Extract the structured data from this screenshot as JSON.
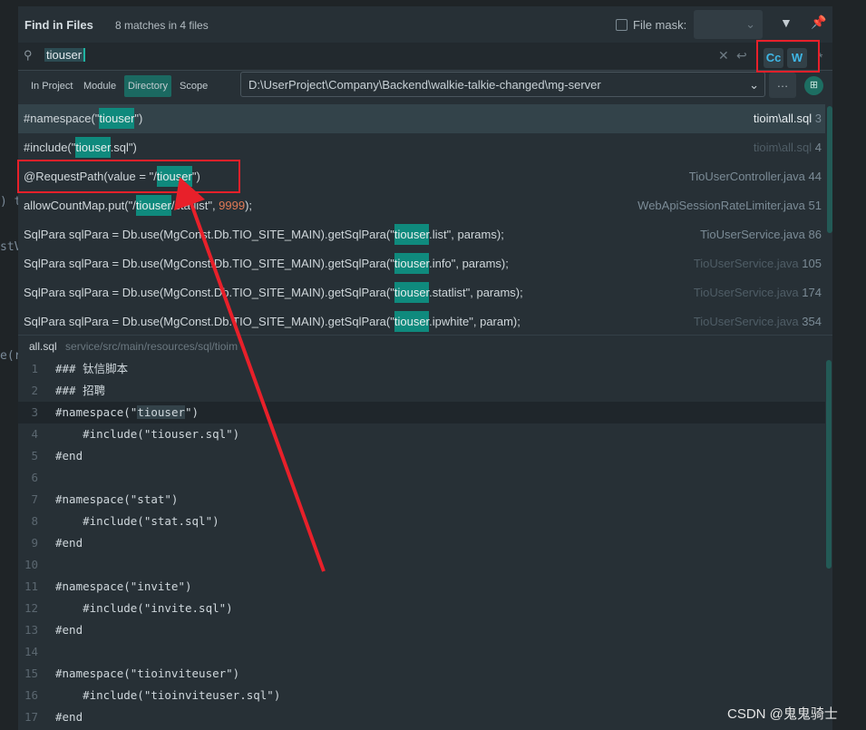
{
  "dialog": {
    "title": "Find in Files",
    "match_count": "8 matches in 4 files",
    "file_mask_label": "File mask:",
    "file_mask_checked": false
  },
  "search": {
    "query": "tiouser",
    "match_case": "Cc",
    "words": "W",
    "regex": "*"
  },
  "scopes": [
    {
      "label": "In Project",
      "selected": false
    },
    {
      "label": "Module",
      "selected": false
    },
    {
      "label": "Directory",
      "selected": true
    },
    {
      "label": "Scope",
      "selected": false
    }
  ],
  "directory": "D:\\UserProject\\Company\\Backend\\walkie-talkie-changed\\mg-server",
  "results": [
    {
      "pre": "#namespace(\"",
      "match": "tiouser",
      "post": "\")",
      "file": "tioim\\all.sql",
      "line": "3",
      "selected": true
    },
    {
      "pre": "#include(\"",
      "match": "tiouser",
      "post": ".sql\")",
      "file": "tioim\\all.sql",
      "line": "4"
    },
    {
      "pre": "@RequestPath(value = \"/",
      "match": "tiouser",
      "post": "\")",
      "file": "TioUserController.java",
      "line": "44"
    },
    {
      "pre": "allowCountMap.put(\"/",
      "match": "tiouser",
      "post": "/statlist\", ",
      "num": "9999",
      "post2": ");",
      "file": "WebApiSessionRateLimiter.java",
      "line": "51"
    },
    {
      "pre": "SqlPara sqlPara = Db.use(MgConst.Db.TIO_SITE_MAIN).getSqlPara(\"",
      "match": "tiouser",
      "post": ".list\", params);",
      "file": "TioUserService.java",
      "line": "86"
    },
    {
      "pre": "SqlPara sqlPara = Db.use(MgConst.Db.TIO_SITE_MAIN).getSqlPara(\"",
      "match": "tiouser",
      "post": ".info\", params);",
      "file": "TioUserService.java",
      "line": "105"
    },
    {
      "pre": "SqlPara sqlPara = Db.use(MgConst.Db.TIO_SITE_MAIN).getSqlPara(\"",
      "match": "tiouser",
      "post": ".statlist\", params);",
      "file": "TioUserService.java",
      "line": "174"
    },
    {
      "pre": "SqlPara sqlPara = Db.use(MgConst.Db.TIO_SITE_MAIN).getSqlPara(\"",
      "match": "tiouser",
      "post": ".ipwhite\", param);",
      "file": "TioUserService.java",
      "line": "354"
    }
  ],
  "preview": {
    "file": "all.sql",
    "path": "service/src/main/resources/sql/tioim",
    "lines": [
      "### 钛信脚本",
      "### 招聘",
      "#namespace(\"tiouser\")",
      "    #include(\"tiouser.sql\")",
      "#end",
      "",
      "#namespace(\"stat\")",
      "    #include(\"stat.sql\")",
      "#end",
      "",
      "#namespace(\"invite\")",
      "    #include(\"invite.sql\")",
      "#end",
      "",
      "#namespace(\"tioinviteuser\")",
      "    #include(\"tioinviteuser.sql\")",
      "#end"
    ]
  },
  "watermark": "CSDN @鬼鬼骑士",
  "annotation_color": "#e8202a"
}
